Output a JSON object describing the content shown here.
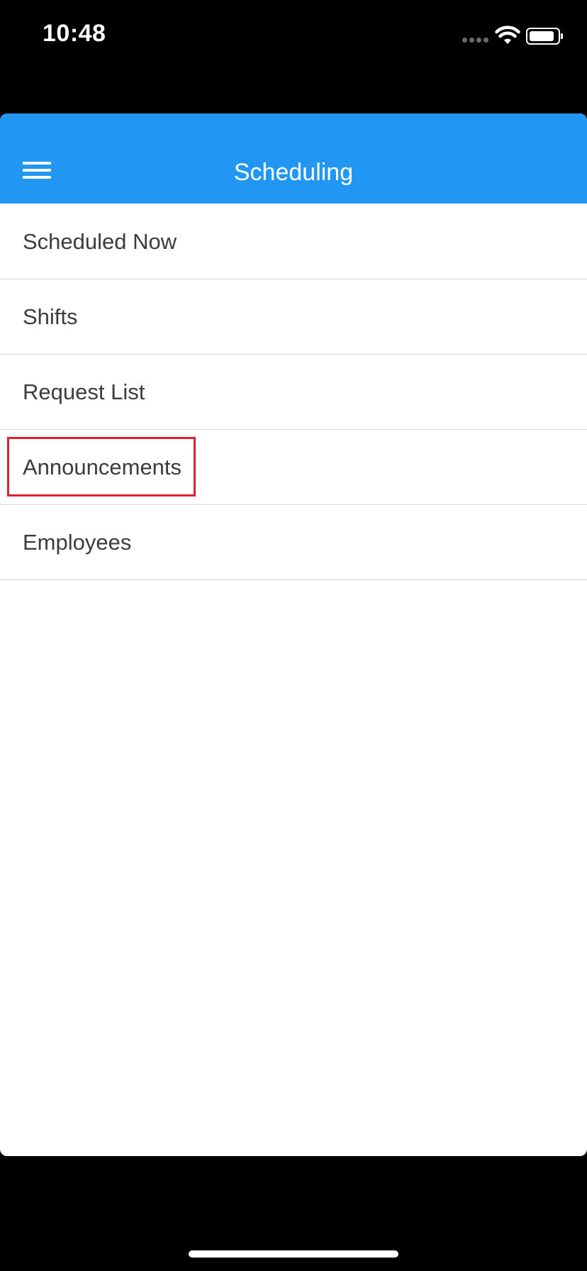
{
  "status_bar": {
    "time": "10:48"
  },
  "header": {
    "title": "Scheduling",
    "color": "#2196f3"
  },
  "menu": {
    "items": [
      {
        "label": "Scheduled Now"
      },
      {
        "label": "Shifts"
      },
      {
        "label": "Request List"
      },
      {
        "label": "Announcements",
        "highlighted": true
      },
      {
        "label": "Employees"
      }
    ]
  },
  "highlight_color": "#e0202e",
  "icons": {
    "menu": "hamburger-menu-icon",
    "signal": "cellular-signal-icon",
    "wifi": "wifi-icon",
    "battery": "battery-icon"
  }
}
